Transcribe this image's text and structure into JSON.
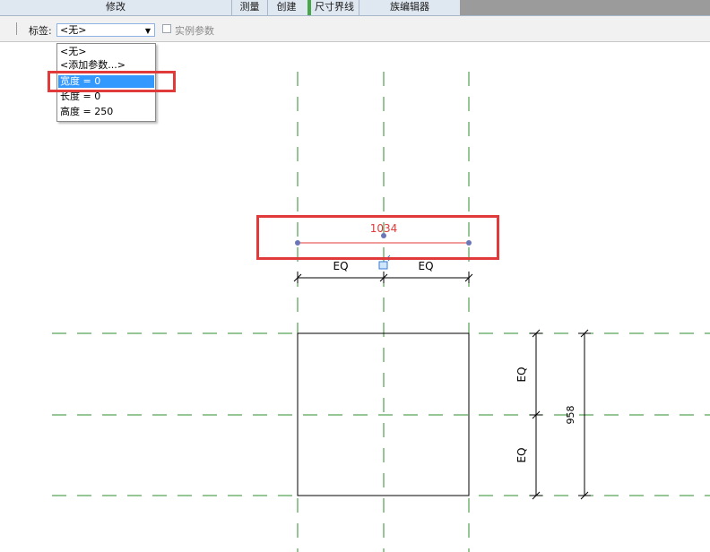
{
  "ribbon": {
    "tabs": [
      {
        "label": "修改"
      },
      {
        "label": "测量"
      },
      {
        "label": "创建"
      },
      {
        "label": "尺寸界线"
      },
      {
        "label": "族编辑器"
      }
    ]
  },
  "options_bar": {
    "label": "标签:",
    "select_value": "<无>",
    "checkbox_label": "实例参数",
    "checkbox_checked": false
  },
  "dropdown": {
    "items": [
      {
        "label": "<无>"
      },
      {
        "label": "<添加参数...>"
      },
      {
        "label": "宽度 = 0",
        "selected": true
      },
      {
        "label": "长度 = 0"
      },
      {
        "label": "高度 = 250"
      }
    ]
  },
  "drawing": {
    "selected_dimension_value": "1034",
    "eq_label": "EQ",
    "vertical_dimension_value": "958",
    "colors": {
      "reference_plane": "#2e8b2e",
      "selected_dimension": "#e03a3a",
      "highlight": "#e03a3a",
      "dimension_line": "#000000"
    }
  }
}
